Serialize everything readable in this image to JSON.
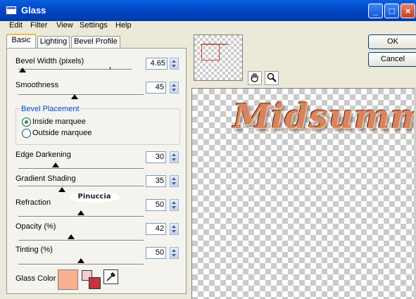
{
  "window": {
    "title": "Glass"
  },
  "titlebar": {
    "minimize": "_",
    "maximize": "□",
    "close": "×"
  },
  "menubar": [
    "Edit",
    "Filter",
    "View",
    "Settings",
    "Help"
  ],
  "tabs": [
    {
      "label": "Basic",
      "active": true
    },
    {
      "label": "Lighting",
      "active": false
    },
    {
      "label": "Bevel Profile",
      "active": false
    }
  ],
  "controls": {
    "bevel_width": {
      "label": "Bevel Width (pixels)",
      "value": "4.65",
      "level": 0.04
    },
    "smoothness": {
      "label": "Smoothness",
      "value": "45",
      "level": 0.45
    },
    "bevel_placement": {
      "title": "Bevel Placement",
      "options": [
        {
          "label": "Inside marquee",
          "selected": true
        },
        {
          "label": "Outside marquee",
          "selected": false
        }
      ]
    },
    "edge_darkening": {
      "label": "Edge Darkening",
      "value": "30",
      "level": 0.3
    },
    "gradient_shading": {
      "label": "Gradient Shading",
      "value": "35",
      "level": 0.35
    },
    "refraction": {
      "label": "Refraction",
      "value": "50",
      "level": 0.5
    },
    "opacity": {
      "label": "Opacity (%)",
      "value": "42",
      "level": 0.42
    },
    "tinting": {
      "label": "Tinting (%)",
      "value": "50",
      "level": 0.5
    },
    "glass_color": {
      "label": "Glass Color",
      "color": "#f8b08e"
    }
  },
  "buttons": {
    "ok": "OK",
    "cancel": "Cancel"
  },
  "preview": {
    "text": "Midsumm"
  },
  "watermark": "Pinuccia",
  "icons": {
    "pan": "hand-icon",
    "zoom": "magnifier-icon",
    "dropper": "eyedropper-icon"
  },
  "colors": {
    "accent": "#0a5fe0",
    "group_title": "#0046d5"
  }
}
